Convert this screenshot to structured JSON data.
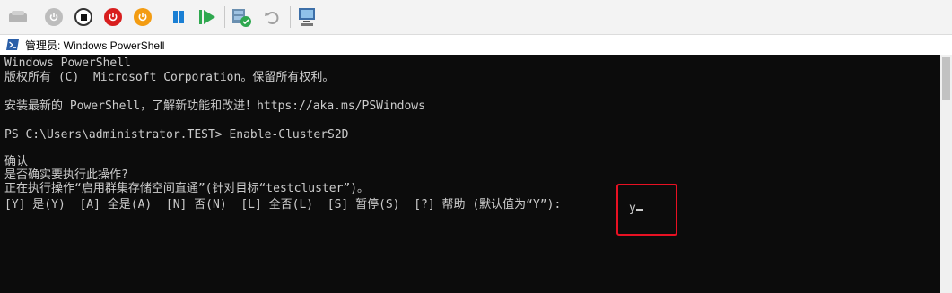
{
  "window": {
    "title": "管理员: Windows PowerShell"
  },
  "toolbar": {
    "buttons": [
      {
        "name": "ctrl-alt-del",
        "icon": "keyboard-icon"
      },
      {
        "name": "start",
        "icon": "start-icon"
      },
      {
        "name": "turn-off",
        "icon": "stop-icon"
      },
      {
        "name": "shutdown",
        "icon": "power-icon"
      },
      {
        "name": "save",
        "icon": "save-state-icon"
      },
      {
        "name": "pause",
        "icon": "pause-icon"
      },
      {
        "name": "reset",
        "icon": "reset-icon"
      },
      {
        "name": "checkpoint",
        "icon": "checkpoint-icon"
      },
      {
        "name": "revert",
        "icon": "revert-icon"
      },
      {
        "name": "enhanced-session",
        "icon": "enhanced-session-icon"
      }
    ]
  },
  "console": {
    "lines": [
      "Windows PowerShell",
      "版权所有 (C)  Microsoft Corporation。保留所有权利。",
      "",
      "安装最新的 PowerShell，了解新功能和改进！https://aka.ms/PSWindows",
      "",
      "PS C:\\Users\\administrator.TEST> Enable-ClusterS2D",
      "",
      "确认",
      "是否确实要执行此操作?",
      "正在执行操作“启用群集存储空间直通”(针对目标“testcluster”)。",
      "[Y] 是(Y)  [A] 全是(A)  [N] 否(N)  [L] 全否(L)  [S] 暂停(S)  [?] 帮助 (默认值为“Y”): "
    ],
    "input": "y"
  },
  "colors": {
    "console_bg": "#0c0c0c",
    "console_fg": "#cccccc",
    "highlight_border": "#e81123"
  }
}
